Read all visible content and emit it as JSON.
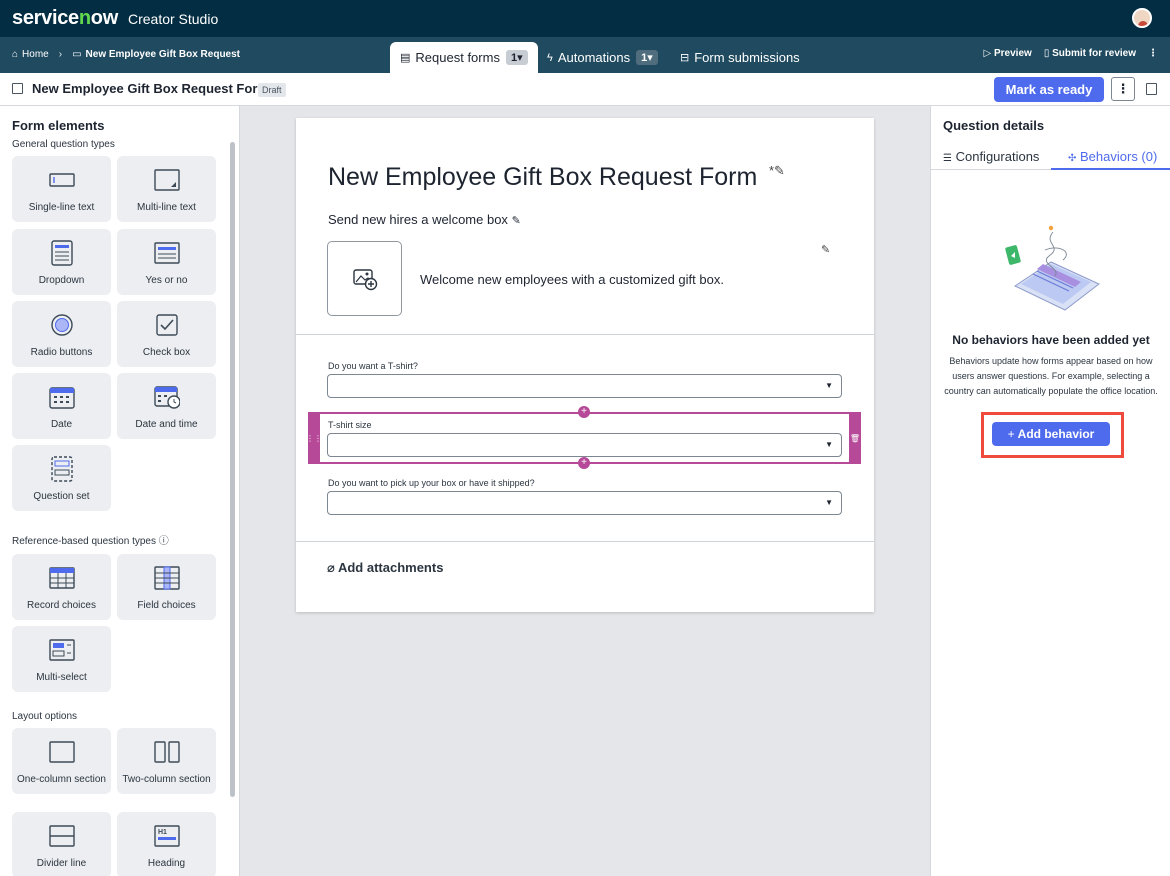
{
  "topbar": {
    "brand": "servicenow",
    "app_name": "Creator Studio"
  },
  "breadcrumb": {
    "home": "Home",
    "current": "New Employee Gift Box Request"
  },
  "tabs": [
    {
      "label": "Request forms",
      "badge": "1▾",
      "icon": "form-icon"
    },
    {
      "label": "Automations",
      "badge": "1▾",
      "icon": "bolt-icon"
    },
    {
      "label": "Form submissions",
      "icon": "inbox-icon"
    }
  ],
  "subnav_actions": {
    "preview": "Preview",
    "submit": "Submit for review"
  },
  "titlebar": {
    "title": "New Employee Gift Box Request Form",
    "status": "Draft",
    "mark_ready": "Mark as ready"
  },
  "left": {
    "heading": "Form elements",
    "general_label": "General question types",
    "general": [
      "Single-line text",
      "Multi-line text",
      "Dropdown",
      "Yes or no",
      "Radio buttons",
      "Check box",
      "Date",
      "Date and time",
      "Question set"
    ],
    "reference_label": "Reference-based question types",
    "reference": [
      "Record choices",
      "Field choices",
      "Multi-select"
    ],
    "layout_label": "Layout options",
    "layout": [
      "One-column section",
      "Two-column section",
      "Divider line",
      "Heading"
    ]
  },
  "form": {
    "title": "New Employee Gift Box Request Form",
    "subtitle": "Send new hires a welcome box",
    "welcome": "Welcome new employees with a customized gift box.",
    "questions": [
      "Do you want a T-shirt?",
      "T-shirt size",
      "Do you want to pick up your box or have it shipped?"
    ],
    "attachments": "Add attachments"
  },
  "right": {
    "heading": "Question details",
    "tab_config": "Configurations",
    "tab_behaviors": "Behaviors (0)",
    "empty_title": "No behaviors have been added yet",
    "empty_body": "Behaviors update how forms appear based on how users answer questions. For example, selecting a country can automatically populate the office location.",
    "add_button": "Add behavior"
  },
  "colors": {
    "accent": "#4f6bed",
    "selection": "#b64a98",
    "highlight": "#ee4b3c",
    "topbar": "#032d42"
  }
}
